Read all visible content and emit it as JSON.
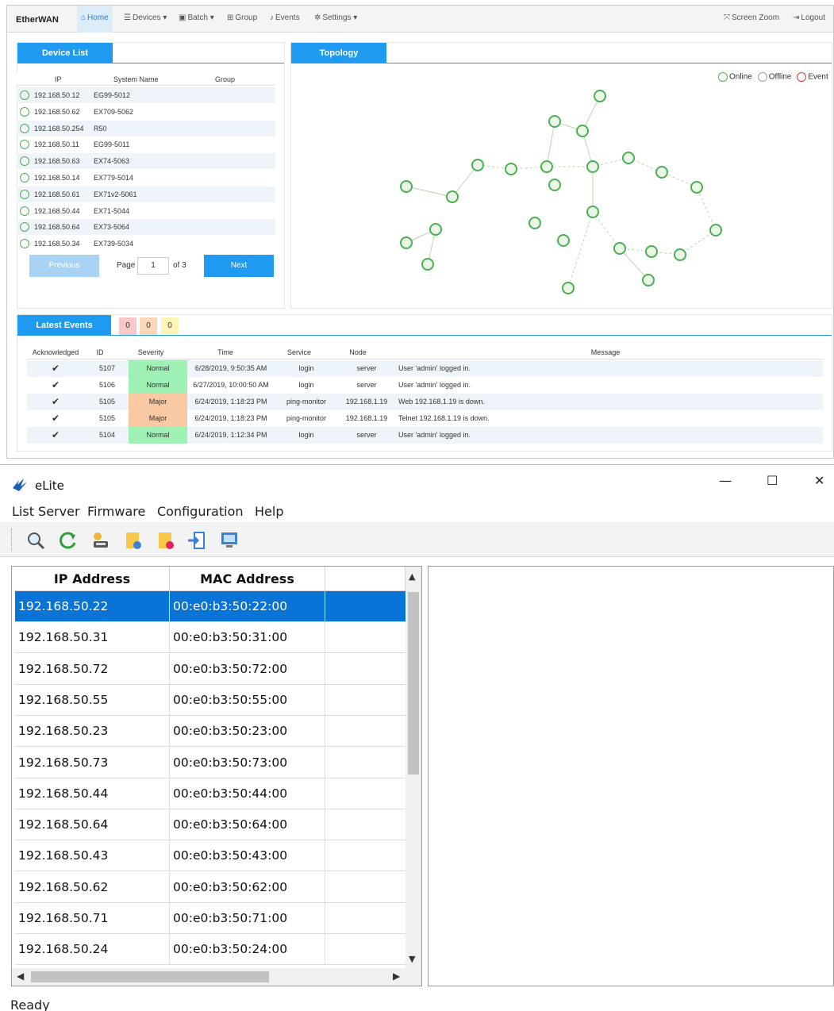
{
  "etherwan": {
    "brand": "EtherWAN",
    "nav": {
      "home": "Home",
      "devices": "Devices",
      "batch": "Batch",
      "group": "Group",
      "events": "Events",
      "settings": "Settings",
      "screen_zoom": "Screen Zoom",
      "logout": "Logout"
    },
    "device_list": {
      "tab": "Device List",
      "columns": [
        "IP",
        "System Name",
        "Group"
      ],
      "rows": [
        {
          "ip": "192.168.50.12",
          "name": "EG99-5012",
          "group": ""
        },
        {
          "ip": "192.168.50.62",
          "name": "EX709-5062",
          "group": ""
        },
        {
          "ip": "192.168.50.254",
          "name": "R50",
          "group": ""
        },
        {
          "ip": "192.168.50.11",
          "name": "EG99-5011",
          "group": ""
        },
        {
          "ip": "192.168.50.63",
          "name": "EX74-5063",
          "group": ""
        },
        {
          "ip": "192.168.50.14",
          "name": "EX779-5014",
          "group": ""
        },
        {
          "ip": "192.168.50.61",
          "name": "EX71v2-5061",
          "group": ""
        },
        {
          "ip": "192.168.50.44",
          "name": "EX71-5044",
          "group": ""
        },
        {
          "ip": "192.168.50.64",
          "name": "EX73-5064",
          "group": ""
        },
        {
          "ip": "192.168.50.34",
          "name": "EX739-5034",
          "group": ""
        }
      ],
      "pager": {
        "previous": "Previous",
        "page_label": "Page",
        "page": "1",
        "of": "of 3",
        "next": "Next"
      }
    },
    "topology": {
      "tab": "Topology",
      "legend": {
        "online": "Online",
        "offline": "Offline",
        "event": "Event"
      },
      "colors": {
        "online": "#4caf50",
        "offline": "#9e9e9e",
        "event": "#e53935"
      }
    },
    "latest_events": {
      "tab": "Latest Events",
      "badges": [
        "0",
        "0",
        "0"
      ],
      "columns": [
        "Acknowledged",
        "ID",
        "Severity",
        "Time",
        "Service",
        "Node",
        "Message"
      ],
      "rows": [
        {
          "ack": "✔",
          "id": "5107",
          "severity": "Normal",
          "time": "6/28/2019, 9:50:35 AM",
          "service": "login",
          "node": "server",
          "message": "User 'admin' logged in."
        },
        {
          "ack": "✔",
          "id": "5106",
          "severity": "Normal",
          "time": "6/27/2019, 10:00:50 AM",
          "service": "login",
          "node": "server",
          "message": "User 'admin' logged in."
        },
        {
          "ack": "✔",
          "id": "5105",
          "severity": "Major",
          "time": "6/24/2019, 1:18:23 PM",
          "service": "ping-monitor",
          "node": "192.168.1.19",
          "message": "Web 192.168.1.19 is down."
        },
        {
          "ack": "✔",
          "id": "5105",
          "severity": "Major",
          "time": "6/24/2019, 1:18:23 PM",
          "service": "ping-monitor",
          "node": "192.168.1.19",
          "message": "Telnet 192.168.1.19 is down."
        },
        {
          "ack": "✔",
          "id": "5104",
          "severity": "Normal",
          "time": "6/24/2019, 1:12:34 PM",
          "service": "login",
          "node": "server",
          "message": "User 'admin' logged in."
        }
      ],
      "severity_colors": {
        "Normal": "#9ef0b4",
        "Major": "#f9c9a3"
      }
    }
  },
  "elite": {
    "title": "eLite",
    "window_controls": {
      "minimize": "—",
      "maximize": "☐",
      "close": "✕"
    },
    "menu": [
      "List Server",
      "Firmware",
      "Configuration",
      "Help"
    ],
    "toolbar_icons": [
      "search-icon",
      "refresh-icon",
      "key-icon",
      "folder-upload-icon",
      "folder-delete-icon",
      "import-icon",
      "monitor-icon"
    ],
    "table": {
      "columns": [
        "IP Address",
        "MAC Address"
      ],
      "rows": [
        {
          "ip": "192.168.50.22",
          "mac": "00:e0:b3:50:22:00"
        },
        {
          "ip": "192.168.50.31",
          "mac": "00:e0:b3:50:31:00"
        },
        {
          "ip": "192.168.50.72",
          "mac": "00:e0:b3:50:72:00"
        },
        {
          "ip": "192.168.50.55",
          "mac": "00:e0:b3:50:55:00"
        },
        {
          "ip": "192.168.50.23",
          "mac": "00:e0:b3:50:23:00"
        },
        {
          "ip": "192.168.50.73",
          "mac": "00:e0:b3:50:73:00"
        },
        {
          "ip": "192.168.50.44",
          "mac": "00:e0:b3:50:44:00"
        },
        {
          "ip": "192.168.50.64",
          "mac": "00:e0:b3:50:64:00"
        },
        {
          "ip": "192.168.50.43",
          "mac": "00:e0:b3:50:43:00"
        },
        {
          "ip": "192.168.50.62",
          "mac": "00:e0:b3:50:62:00"
        },
        {
          "ip": "192.168.50.71",
          "mac": "00:e0:b3:50:71:00"
        },
        {
          "ip": "192.168.50.24",
          "mac": "00:e0:b3:50:24:00"
        }
      ],
      "selected_index": 0
    },
    "status": "Ready"
  }
}
